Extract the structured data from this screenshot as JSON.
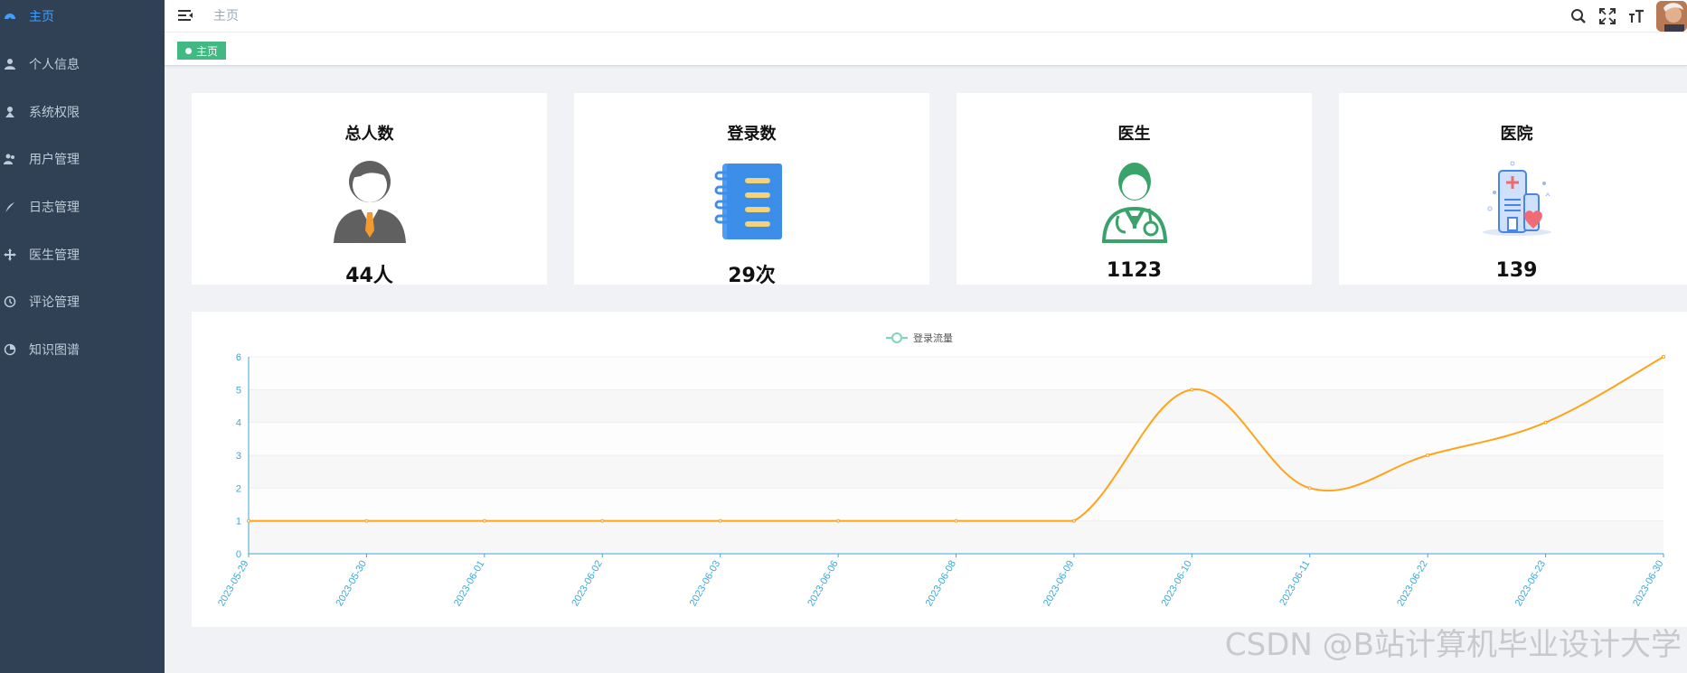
{
  "sidebar": {
    "items": [
      {
        "label": "主页",
        "icon": "dashboard-icon",
        "active": true
      },
      {
        "label": "个人信息",
        "icon": "user-icon"
      },
      {
        "label": "系统权限",
        "icon": "permission-user-icon"
      },
      {
        "label": "用户管理",
        "icon": "users-icon"
      },
      {
        "label": "日志管理",
        "icon": "feather-icon"
      },
      {
        "label": "医生管理",
        "icon": "move-arrows-icon"
      },
      {
        "label": "评论管理",
        "icon": "clock-icon"
      },
      {
        "label": "知识图谱",
        "icon": "graph-icon"
      }
    ]
  },
  "header": {
    "breadcrumb": "主页",
    "icons": [
      "search-icon",
      "fullscreen-icon",
      "font-size-icon",
      "avatar"
    ]
  },
  "tags": [
    {
      "label": "主页",
      "active": true,
      "color": "#42b983"
    }
  ],
  "cards": [
    {
      "title": "总人数",
      "value": "44人",
      "icon": "businessman-icon"
    },
    {
      "title": "登录数",
      "value": "29次",
      "icon": "notebook-icon"
    },
    {
      "title": "医生",
      "value": "1123",
      "icon": "doctor-icon"
    },
    {
      "title": "医院",
      "value": "139",
      "icon": "hospital-icon"
    }
  ],
  "chart_data": {
    "type": "line",
    "smooth": true,
    "title": "",
    "legend": [
      "登录流量"
    ],
    "legend_position": "top-center",
    "categories": [
      "2023-05-29",
      "2023-05-30",
      "2023-06-01",
      "2023-06-02",
      "2023-06-03",
      "2023-06-06",
      "2023-06-08",
      "2023-06-09",
      "2023-06-10",
      "2023-06-11",
      "2023-06-22",
      "2023-06-23",
      "2023-06-30"
    ],
    "series": [
      {
        "name": "登录流量",
        "values": [
          1,
          1,
          1,
          1,
          1,
          1,
          1,
          1,
          5,
          2,
          3,
          4,
          6
        ],
        "color": "#ffa31a"
      }
    ],
    "ylim": [
      0,
      6
    ],
    "yticks": [
      0,
      1,
      2,
      3,
      4,
      5,
      6
    ],
    "grid": true,
    "axis_color": "#3fa7d6",
    "split_area": true
  },
  "watermark": "CSDN @B站计算机毕业设计大学"
}
